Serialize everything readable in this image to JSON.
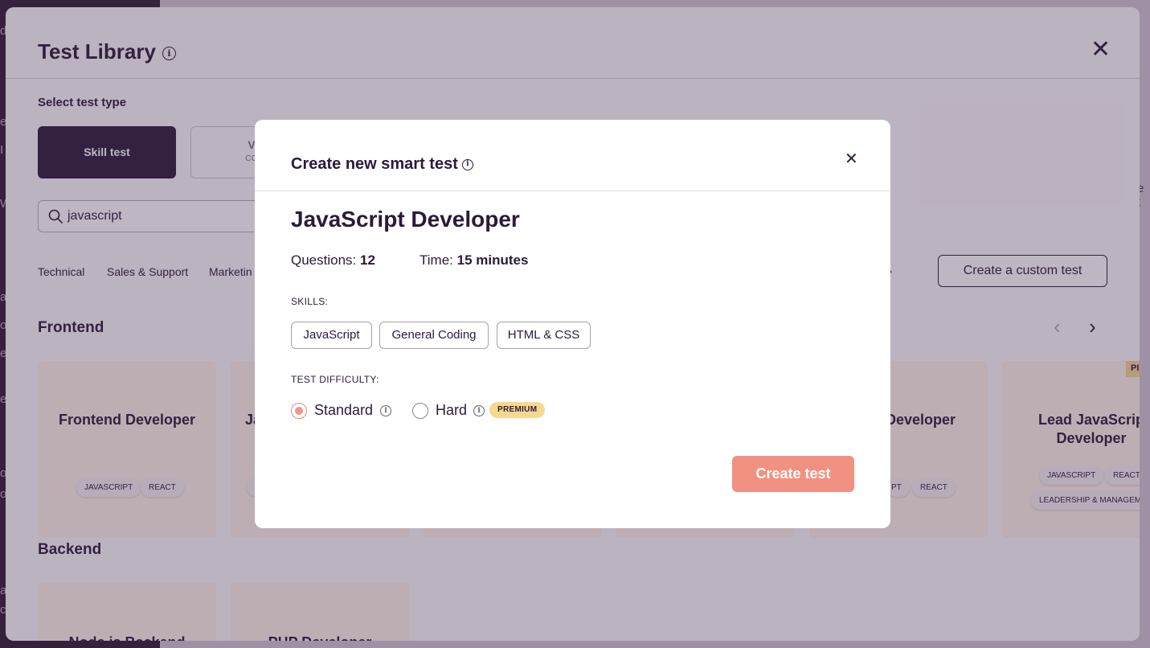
{
  "background": {
    "left_fragments": [
      "d",
      "es",
      "I",
      "W",
      "ay",
      "o",
      "ec",
      "e",
      "oi",
      "o",
      "a",
      "c"
    ],
    "right_fragment": "e t"
  },
  "library": {
    "title": "Test Library",
    "select_label": "Select test type",
    "test_types": [
      {
        "label": "Skill test",
        "sub": "",
        "selected": true
      },
      {
        "label": "Vide",
        "sub": "COMIN",
        "selected": false
      }
    ],
    "search": {
      "value": "javascript"
    },
    "categories": [
      "Technical",
      "Sales & Support",
      "Marketin"
    ],
    "custom_test_label": "Create a custom test",
    "sections": [
      {
        "title": "Frontend",
        "cards": [
          {
            "title": "Frontend Developer",
            "tags": [
              "JAVASCRIPT",
              "REACT"
            ]
          },
          {
            "title": "Ja",
            "tags": [
              ""
            ]
          },
          {
            "title": "",
            "tags": []
          },
          {
            "title": "",
            "tags": []
          },
          {
            "title": "Developer",
            "tags": [
              "PT",
              "REACT"
            ]
          },
          {
            "title": "Lead JavaScrip Developer",
            "tags": [
              "JAVASCRIPT",
              "REACT",
              "LEADERSHIP & MANAGEMENT"
            ],
            "badge": "PI"
          }
        ]
      },
      {
        "title": "Backend",
        "cards": [
          {
            "title": "Node.js Backend"
          },
          {
            "title": "PHP Developer"
          }
        ]
      }
    ]
  },
  "modal": {
    "title": "Create new smart test",
    "test_name": "JavaScript Developer",
    "questions_label": "Questions:",
    "questions_value": "12",
    "time_label": "Time:",
    "time_value": "15 minutes",
    "skills_label": "SKILLS:",
    "skills": [
      "JavaScript",
      "General Coding",
      "HTML & CSS"
    ],
    "difficulty_label": "TEST DIFFICULTY:",
    "difficulty_options": [
      {
        "label": "Standard",
        "selected": true
      },
      {
        "label": "Hard",
        "selected": false,
        "badge": "PREMIUM"
      }
    ],
    "create_button": "Create test"
  },
  "colors": {
    "brand_dark": "#2c1a3a",
    "accent_coral": "#f19181",
    "premium_yellow": "#f7d890",
    "card_bg": "#fdf3e8"
  },
  "icons": {
    "info": "info-icon",
    "close": "close-icon",
    "search": "search-icon",
    "chevron_left": "chevron-left-icon",
    "chevron_right": "chevron-right-icon"
  }
}
